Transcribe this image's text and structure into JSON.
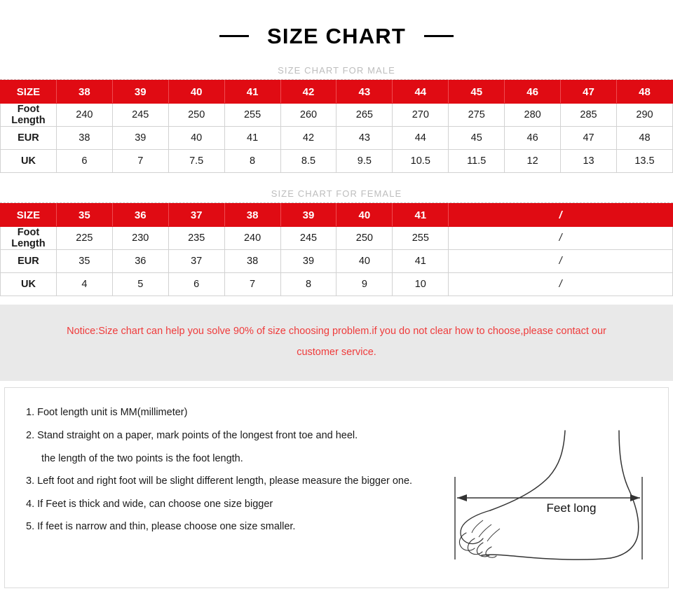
{
  "header": {
    "title": "SIZE CHART",
    "left_dash": "—",
    "right_dash": "—"
  },
  "male_section": {
    "subtitle": "SIZE CHART FOR MALE",
    "row_labels": [
      "SIZE",
      "Foot Length",
      "EUR",
      "UK"
    ],
    "sizes": [
      "38",
      "39",
      "40",
      "41",
      "42",
      "43",
      "44",
      "45",
      "46",
      "47",
      "48"
    ],
    "foot_length": [
      "240",
      "245",
      "250",
      "255",
      "260",
      "265",
      "270",
      "275",
      "280",
      "285",
      "290"
    ],
    "eur": [
      "38",
      "39",
      "40",
      "41",
      "42",
      "43",
      "44",
      "45",
      "46",
      "47",
      "48"
    ],
    "uk": [
      "6",
      "7",
      "7.5",
      "8",
      "8.5",
      "9.5",
      "10.5",
      "11.5",
      "12",
      "13",
      "13.5"
    ]
  },
  "female_section": {
    "subtitle": "SIZE CHART FOR FEMALE",
    "row_labels": [
      "SIZE",
      "Foot Length",
      "EUR",
      "UK"
    ],
    "sizes": [
      "35",
      "36",
      "37",
      "38",
      "39",
      "40",
      "41"
    ],
    "foot_length": [
      "225",
      "230",
      "235",
      "240",
      "245",
      "250",
      "255"
    ],
    "eur": [
      "35",
      "36",
      "37",
      "38",
      "39",
      "40",
      "41"
    ],
    "uk": [
      "4",
      "5",
      "6",
      "7",
      "8",
      "9",
      "10"
    ],
    "empty_marker": "/"
  },
  "notice": {
    "line1": "Notice:Size chart can help you solve 90% of size choosing problem.if you do not clear how to choose,please contact our",
    "line2": "customer service."
  },
  "instructions": [
    "1. Foot length unit is MM(millimeter)",
    "2. Stand straight on a paper, mark points of the longest front toe and heel.",
    "the length of the two points is the foot length.",
    "3. Left foot and right foot will be slight different length, please measure the bigger one.",
    "4. If Feet is thick and wide, can choose one size bigger",
    "5. If feet is narrow and thin, please choose one size smaller."
  ],
  "diagram": {
    "measurement_label": "Feet long"
  },
  "colors": {
    "header_red": "#e00b13",
    "notice_red": "#ef3b3b",
    "notice_band_bg": "#e9e9e9",
    "subtitle_gray": "#bdbdbd",
    "table_border": "#d2d2d2"
  }
}
